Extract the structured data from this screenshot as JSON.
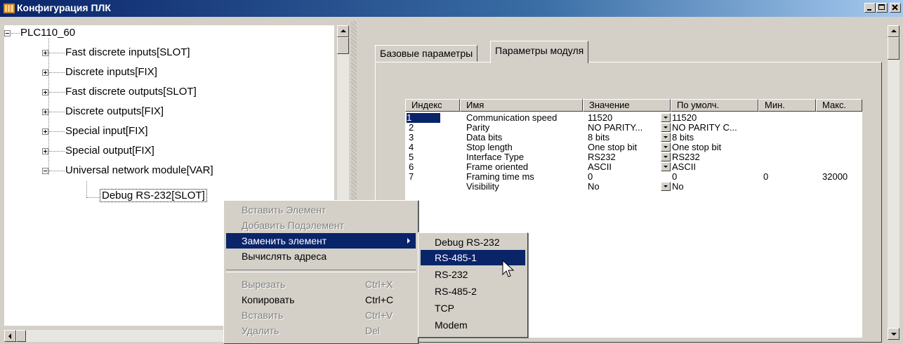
{
  "window": {
    "title": "Конфигурация ПЛК"
  },
  "tree": {
    "root": "PLC110_60",
    "items": [
      "Fast discrete inputs[SLOT]",
      "Discrete inputs[FIX]",
      "Fast discrete outputs[SLOT]",
      "Discrete outputs[FIX]",
      "Special input[FIX]",
      "Special output[FIX]",
      "Universal network module[VAR]"
    ],
    "child": "Debug RS-232[SLOT]"
  },
  "tabs": [
    "Базовые параметры",
    "Параметры модуля"
  ],
  "grid": {
    "headers": [
      "Индекс",
      "Имя",
      "Значение",
      "По умолч.",
      "Мин.",
      "Макс."
    ],
    "rows": [
      {
        "idx": "1",
        "name": "Communication speed",
        "value": "11520",
        "def": "11520",
        "min": "",
        "max": ""
      },
      {
        "idx": "2",
        "name": "Parity",
        "value": "NO PARITY...",
        "def": "NO PARITY C...",
        "min": "",
        "max": ""
      },
      {
        "idx": "3",
        "name": "Data bits",
        "value": "8 bits",
        "def": "8 bits",
        "min": "",
        "max": ""
      },
      {
        "idx": "4",
        "name": "Stop length",
        "value": "One stop bit",
        "def": "One stop bit",
        "min": "",
        "max": ""
      },
      {
        "idx": "5",
        "name": "Interface Type",
        "value": "RS232",
        "def": "RS232",
        "min": "",
        "max": ""
      },
      {
        "idx": "6",
        "name": "Frame oriented",
        "value": "ASCII",
        "def": "ASCII",
        "min": "",
        "max": ""
      },
      {
        "idx": "7",
        "name": "Framing time ms",
        "value": "0",
        "def": "0",
        "min": "0",
        "max": "32000"
      },
      {
        "idx": "",
        "name": "Visibility",
        "value": "No",
        "def": "No",
        "min": "",
        "max": ""
      }
    ]
  },
  "context_menu": {
    "items": [
      {
        "label": "Вставить Элемент",
        "disabled": true
      },
      {
        "label": "Добавить Подэлемент",
        "disabled": true
      },
      {
        "label": "Заменить элемент",
        "highlight": true
      },
      {
        "label": "Вычислять адреса"
      },
      {
        "label": "Вырезать",
        "shortcut": "Ctrl+X",
        "disabled": true
      },
      {
        "label": "Копировать",
        "shortcut": "Ctrl+C"
      },
      {
        "label": "Вставить",
        "shortcut": "Ctrl+V",
        "disabled": true
      },
      {
        "label": "Удалить",
        "shortcut": "Del",
        "disabled": true
      }
    ]
  },
  "submenu": {
    "items": [
      "Debug RS-232",
      "RS-485-1",
      "RS-232",
      "RS-485-2",
      "TCP",
      "Modem"
    ]
  }
}
